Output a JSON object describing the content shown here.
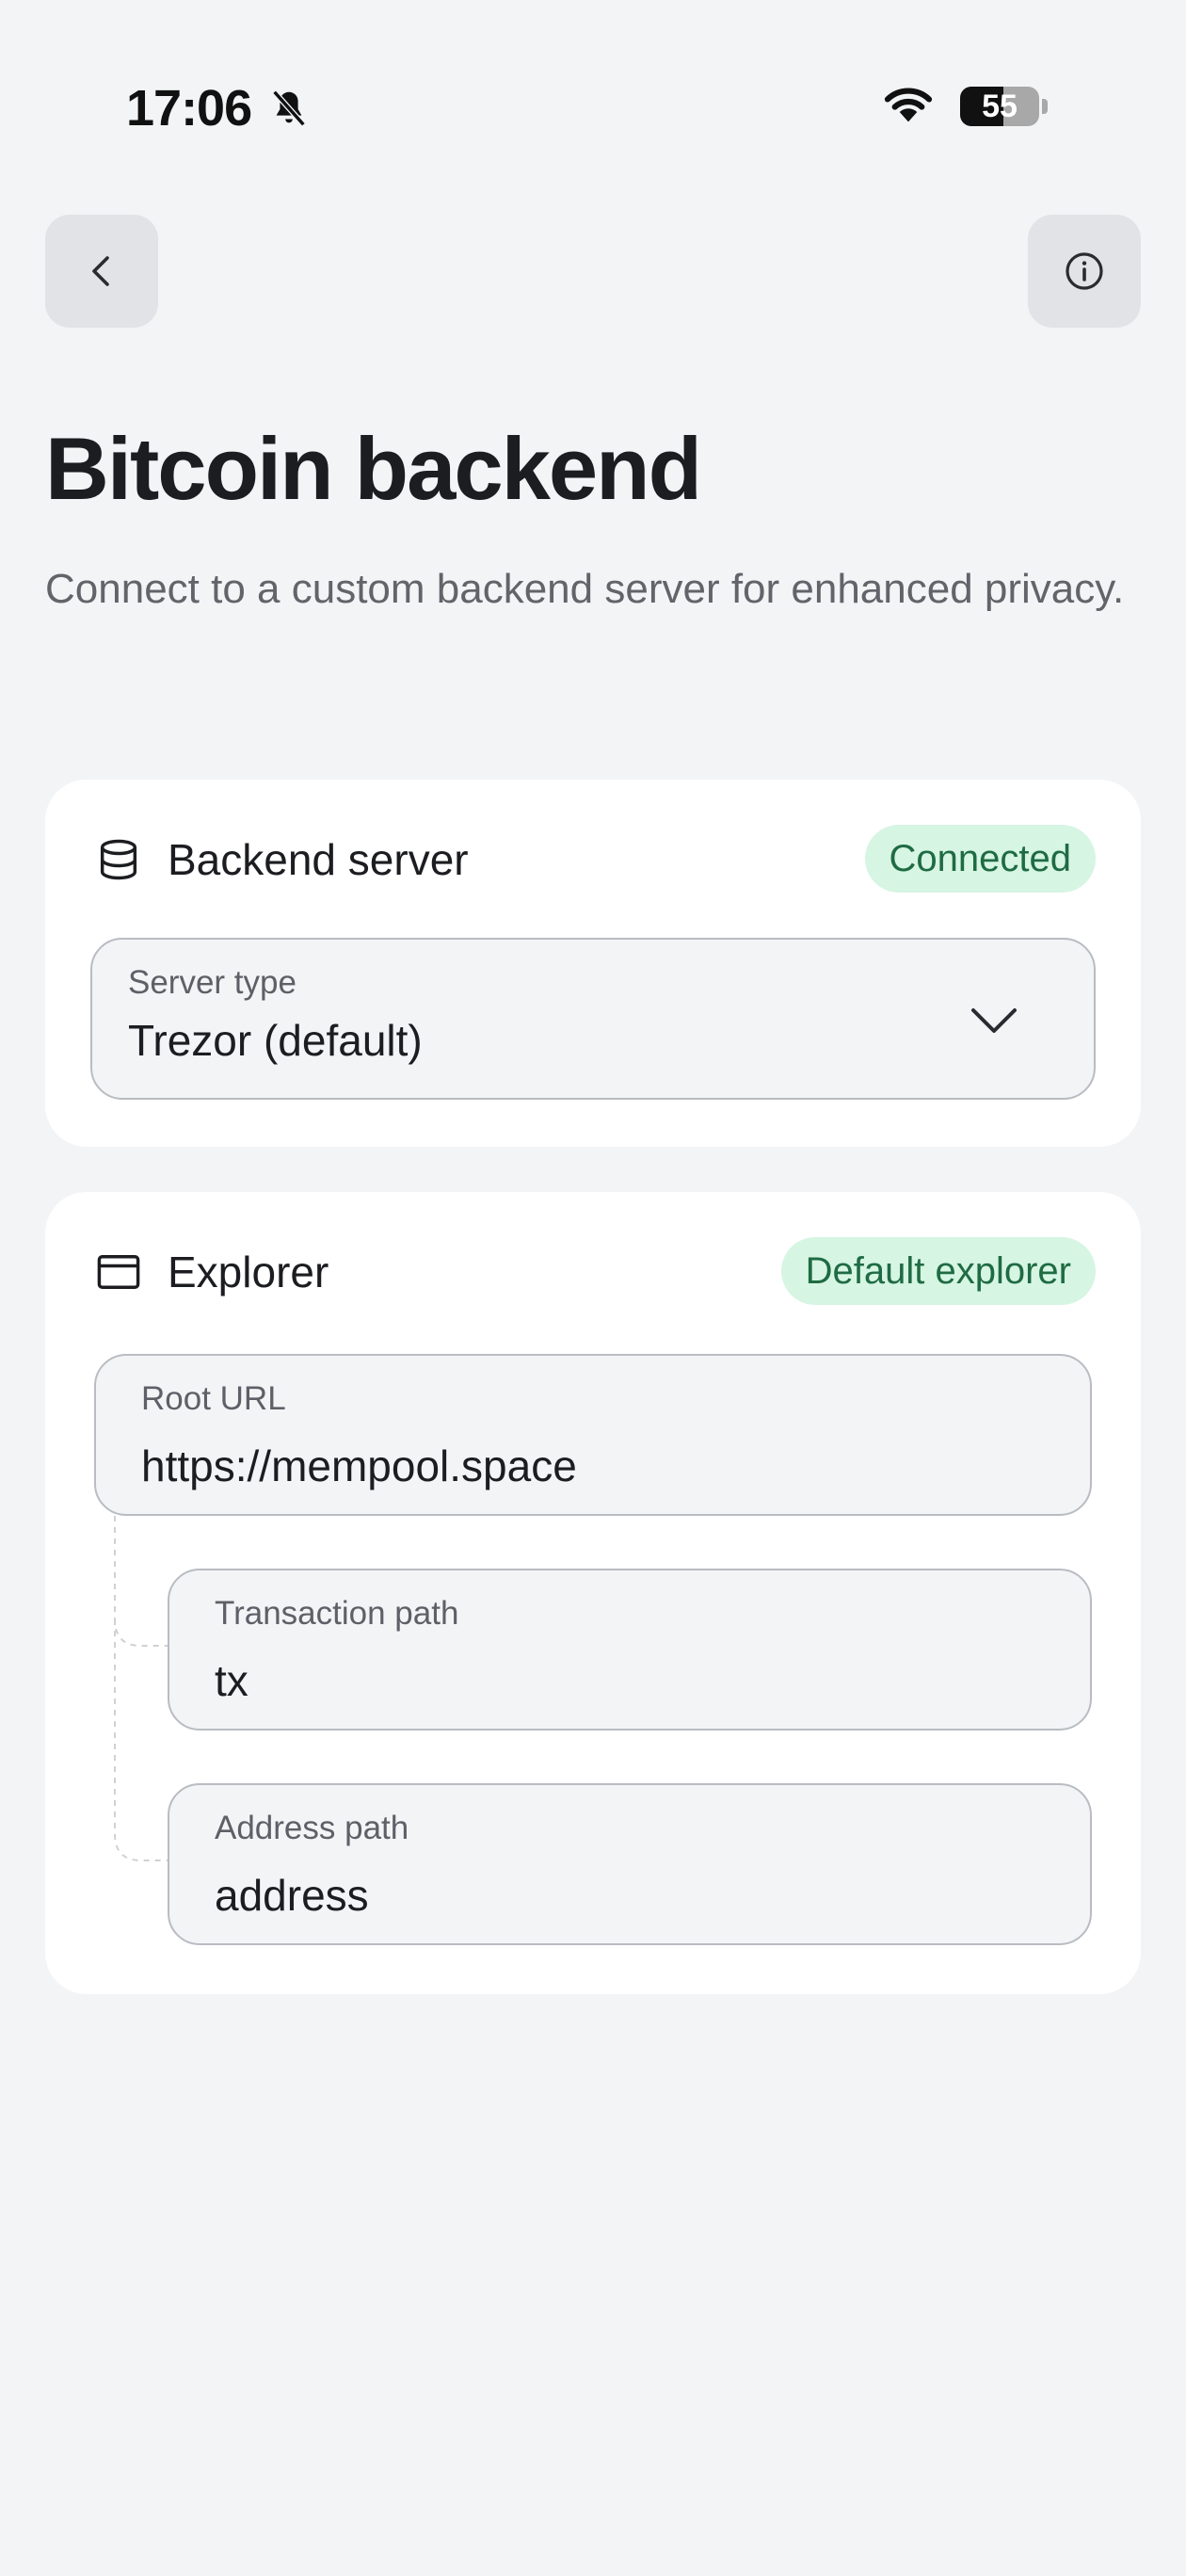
{
  "status_bar": {
    "time": "17:06",
    "battery_level": "55",
    "battery_fraction": 0.55
  },
  "header": {
    "back_icon": "chevron-left-icon",
    "info_icon": "info-icon"
  },
  "page": {
    "title": "Bitcoin backend",
    "subtitle": "Connect to a custom backend server for enhanced privacy."
  },
  "backend_card": {
    "icon": "database-icon",
    "title": "Backend server",
    "status_badge": "Connected",
    "server_type": {
      "label": "Server type",
      "value": "Trezor (default)"
    }
  },
  "explorer_card": {
    "icon": "browser-window-icon",
    "title": "Explorer",
    "status_badge": "Default explorer",
    "root_url": {
      "label": "Root URL",
      "value": "https://mempool.space"
    },
    "transaction_path": {
      "label": "Transaction path",
      "value": "tx"
    },
    "address_path": {
      "label": "Address path",
      "value": "address"
    }
  },
  "colors": {
    "background": "#f3f4f6",
    "card": "#ffffff",
    "badge_bg": "#d6f5e3",
    "badge_text": "#1f6b43",
    "field_border": "#b9bcc2"
  }
}
